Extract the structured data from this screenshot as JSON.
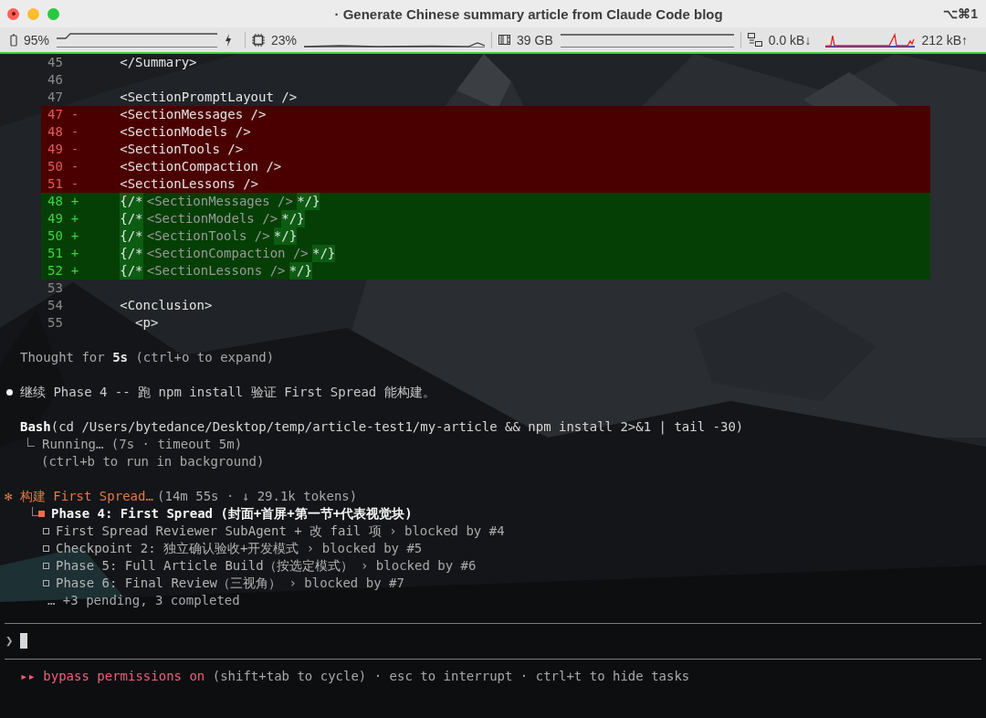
{
  "window": {
    "title": "· Generate Chinese summary article from Claude Code blog",
    "shortcut": "⌥⌘1"
  },
  "status_bar": {
    "battery": "95%",
    "cpu": "23%",
    "memory": "39 GB",
    "download": "0.0 kB↓",
    "upload": "212 kB↑"
  },
  "diff": [
    {
      "kind": "context",
      "number": "45",
      "code": "</Summary>"
    },
    {
      "kind": "context",
      "number": "46"
    },
    {
      "kind": "context",
      "number": "47",
      "code": "<SectionPromptLayout />"
    },
    {
      "kind": "removed",
      "number": "47",
      "sign": "-",
      "code": "<SectionMessages />"
    },
    {
      "kind": "removed",
      "number": "48",
      "sign": "-",
      "code": "<SectionModels />"
    },
    {
      "kind": "removed",
      "number": "49",
      "sign": "-",
      "code": "<SectionTools />"
    },
    {
      "kind": "removed",
      "number": "50",
      "sign": "-",
      "code": "<SectionCompaction />"
    },
    {
      "kind": "removed",
      "number": "51",
      "sign": "-",
      "code": "<SectionLessons />"
    },
    {
      "kind": "added",
      "number": "48",
      "sign": "+",
      "open": "{/*",
      "comment": "<SectionMessages />",
      "close": "*/}"
    },
    {
      "kind": "added",
      "number": "49",
      "sign": "+",
      "open": "{/*",
      "comment": "<SectionModels />",
      "close": "*/}"
    },
    {
      "kind": "added",
      "number": "50",
      "sign": "+",
      "open": "{/*",
      "comment": "<SectionTools />",
      "close": "*/}"
    },
    {
      "kind": "added",
      "number": "51",
      "sign": "+",
      "open": "{/*",
      "comment": "<SectionCompaction />",
      "close": "*/}"
    },
    {
      "kind": "added",
      "number": "52",
      "sign": "+",
      "open": "{/*",
      "comment": "<SectionLessons />",
      "close": "*/}"
    },
    {
      "kind": "context",
      "number": "53"
    },
    {
      "kind": "context",
      "number": "54",
      "code": "<Conclusion>"
    },
    {
      "kind": "context",
      "number": "55",
      "code": "  <p>"
    }
  ],
  "thought": "Thought for **5s** (ctrl+o to expand)",
  "message": "继续 Phase 4 -- 跑 npm install 验证 First Spread 能构建。",
  "tool_call": {
    "command": "**Bash**(cd /Users/bytedance/Desktop/temp/article-test1/my-article && npm install 2>&1 | tail -30)",
    "status": "Running… (7s · timeout 5m)",
    "hint": "(ctrl+b to run in background)"
  },
  "task_progress": {
    "spinner": "✻",
    "label": "构建 First Spread…",
    "stats": "(14m 55s · ↓ 29.1k tokens)",
    "tasks": [
      {
        "active": true,
        "title": "Phase 4: First Spread (封面+首屏+第一节+代表视觉块)"
      },
      {
        "active": false,
        "title": "First Spread Reviewer SubAgent + 改 fail 项",
        "blocked": "› blocked by #4"
      },
      {
        "active": false,
        "title": "Checkpoint 2: 独立确认验收+开发模式",
        "blocked": "› blocked by #5"
      },
      {
        "active": false,
        "title": "Phase 5: Full Article Build（按选定模式）",
        "blocked": "› blocked by #6"
      },
      {
        "active": false,
        "title": "Phase 6: Final Review（三视角）",
        "blocked": "› blocked by #7"
      }
    ],
    "more": "… +3 pending, 3 completed"
  },
  "prompt": {
    "symbol": "❯"
  },
  "footer": {
    "mode": "▸▸ bypass permissions on",
    "hint": "(shift+tab to cycle) · esc to interrupt · ctrl+t to hide tasks"
  }
}
